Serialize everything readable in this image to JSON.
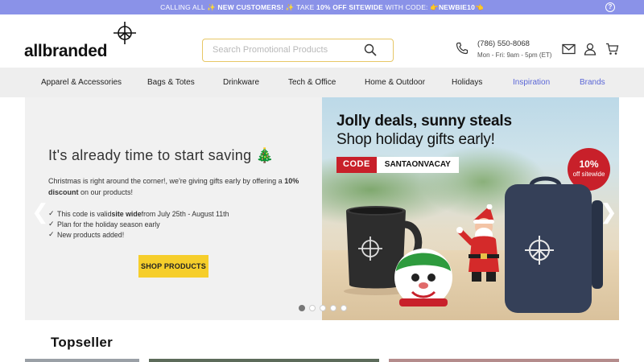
{
  "promo": {
    "part1": "CALLING ALL ✨ ",
    "part2": "NEW CUSTOMERS!",
    "part3": " ✨ TAKE ",
    "part4": "10% OFF SITEWIDE",
    "part5": " WITH CODE: 👉",
    "part6": "NEWBIE10",
    "part7": "👈",
    "help_icon": "?"
  },
  "logo": {
    "text": "allbranded"
  },
  "search": {
    "placeholder": "Search Promotional Products"
  },
  "contact": {
    "phone": "(786) 550-8068",
    "hours": "Mon - Fri: 9am - 5pm (ET)"
  },
  "nav": {
    "items": [
      {
        "label": "Apparel & Accessories"
      },
      {
        "label": "Bags & Totes"
      },
      {
        "label": "Drinkware"
      },
      {
        "label": "Tech & Office"
      },
      {
        "label": "Home & Outdoor"
      },
      {
        "label": "Holidays"
      },
      {
        "label": "Inspiration"
      },
      {
        "label": "Brands"
      }
    ]
  },
  "hero": {
    "headline": "It's already time to start saving 🎄",
    "intro_a": "Christmas is right around the corner!, we're giving gifts early by offering a ",
    "intro_b": "10% discount",
    "intro_c": " on our products!",
    "bullet1_a": "This code is valid ",
    "bullet1_b": "site wide",
    "bullet1_c": " from July 25th - August 11th",
    "bullet2": "Plan for the holiday season early",
    "bullet3": "New products added!",
    "button": "SHOP PRODUCTS",
    "banner_line1": "Jolly deals, sunny steals",
    "banner_line2": "Shop holiday gifts early!",
    "code_label": "CODE",
    "code_value": "SANTAONVACAY",
    "badge_pct": "10%",
    "badge_text": "off sitewide",
    "slide_count": 5,
    "active_slide": 1
  },
  "section": {
    "title": "Topseller"
  },
  "colors": {
    "promo_bar": "#8a92e8",
    "accent": "#5a66d6",
    "cta": "#f6ce2b",
    "badge": "#c8202a"
  }
}
